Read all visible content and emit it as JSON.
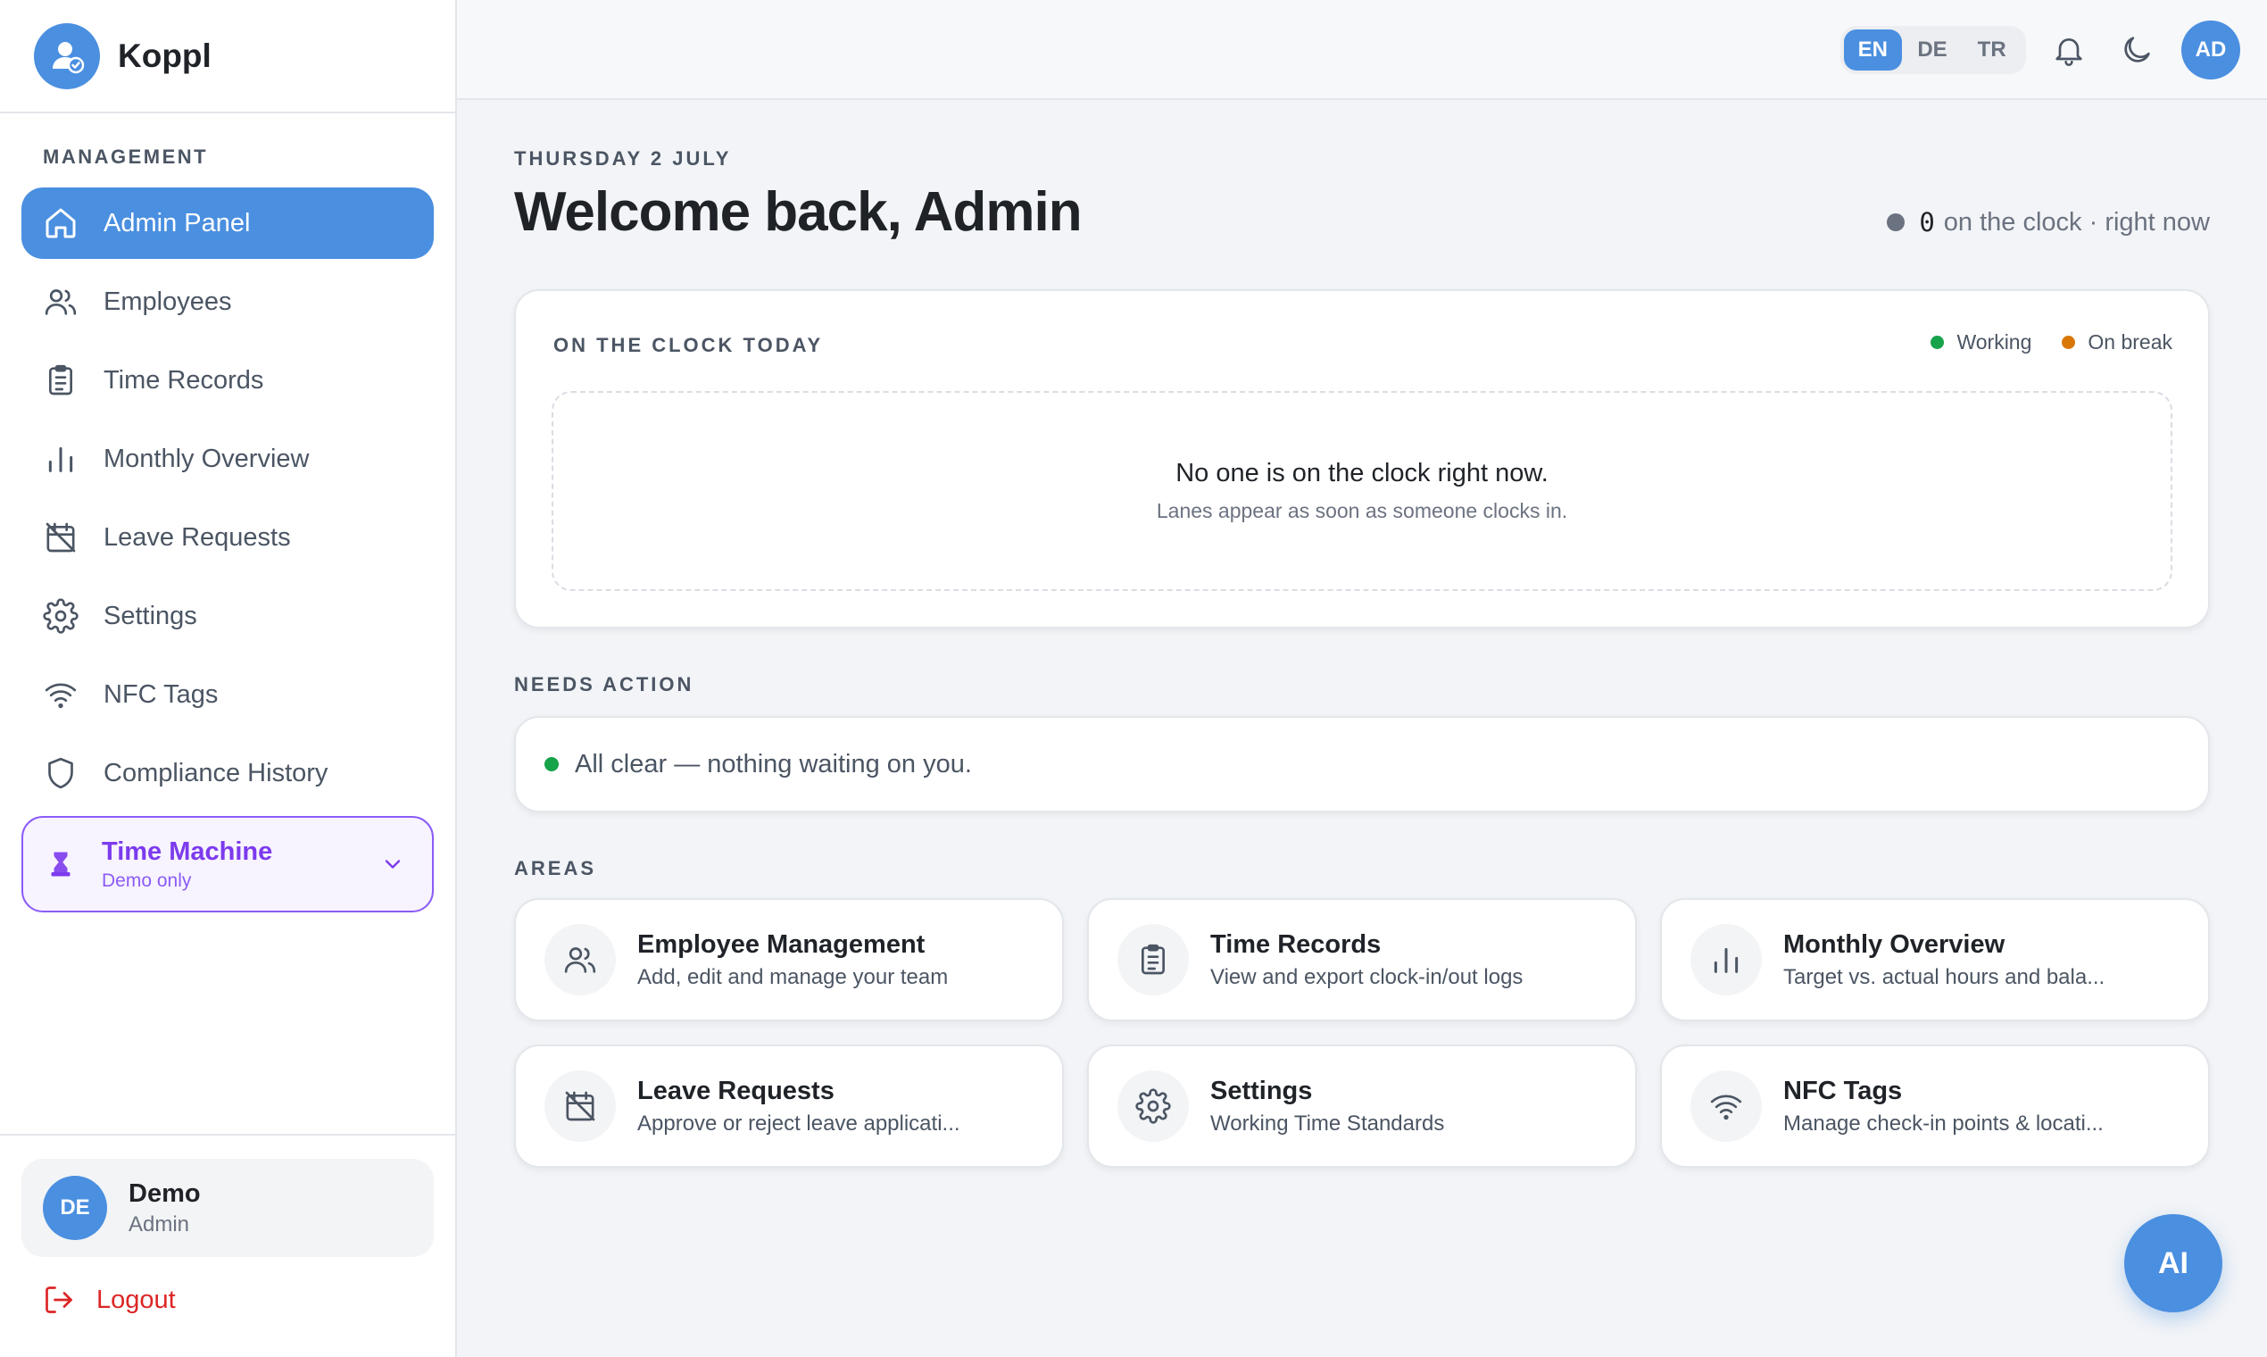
{
  "brand": {
    "name": "Koppl"
  },
  "sidebar": {
    "section_label": "MANAGEMENT",
    "items": [
      {
        "label": "Admin Panel",
        "icon": "home-icon",
        "active": true
      },
      {
        "label": "Employees",
        "icon": "users-icon"
      },
      {
        "label": "Time Records",
        "icon": "clipboard-icon"
      },
      {
        "label": "Monthly Overview",
        "icon": "bar-chart-icon"
      },
      {
        "label": "Leave Requests",
        "icon": "calendar-off-icon"
      },
      {
        "label": "Settings",
        "icon": "gear-icon"
      },
      {
        "label": "NFC Tags",
        "icon": "wifi-icon"
      },
      {
        "label": "Compliance History",
        "icon": "shield-icon"
      }
    ],
    "time_machine": {
      "title": "Time Machine",
      "subtitle": "Demo only",
      "icon": "hourglass-icon"
    },
    "user": {
      "initials": "DE",
      "name": "Demo",
      "role": "Admin"
    },
    "logout_label": "Logout"
  },
  "topbar": {
    "languages": [
      {
        "code": "EN",
        "active": true
      },
      {
        "code": "DE"
      },
      {
        "code": "TR"
      }
    ],
    "avatar_initials": "AD"
  },
  "main": {
    "date_label": "THURSDAY 2 JULY",
    "welcome": "Welcome back, Admin",
    "clock_status": {
      "count": "0",
      "text": "on the clock · right now"
    },
    "clock_card": {
      "title": "ON THE CLOCK TODAY",
      "legend": [
        {
          "label": "Working",
          "color": "#16a34a"
        },
        {
          "label": "On break",
          "color": "#d97706"
        }
      ],
      "empty_title": "No one is on the clock right now.",
      "empty_subtitle": "Lanes appear as soon as someone clocks in."
    },
    "needs_action": {
      "heading": "NEEDS ACTION",
      "text": "All clear — nothing waiting on you.",
      "color": "#16a34a"
    },
    "areas": {
      "heading": "AREAS",
      "cards": [
        {
          "title": "Employee Management",
          "desc": "Add, edit and manage your team",
          "icon": "users-icon"
        },
        {
          "title": "Time Records",
          "desc": "View and export clock-in/out logs",
          "icon": "clipboard-icon"
        },
        {
          "title": "Monthly Overview",
          "desc": "Target vs. actual hours and bala...",
          "icon": "bar-chart-icon"
        },
        {
          "title": "Leave Requests",
          "desc": "Approve or reject leave applicati...",
          "icon": "calendar-off-icon"
        },
        {
          "title": "Settings",
          "desc": "Working Time Standards",
          "icon": "gear-icon"
        },
        {
          "title": "NFC Tags",
          "desc": "Manage check-in points & locati...",
          "icon": "wifi-icon"
        }
      ]
    }
  },
  "ai_button": {
    "label": "AI"
  },
  "colors": {
    "accent": "#4a8fe0",
    "purple": "#7c3aed",
    "danger": "#dc2626"
  }
}
